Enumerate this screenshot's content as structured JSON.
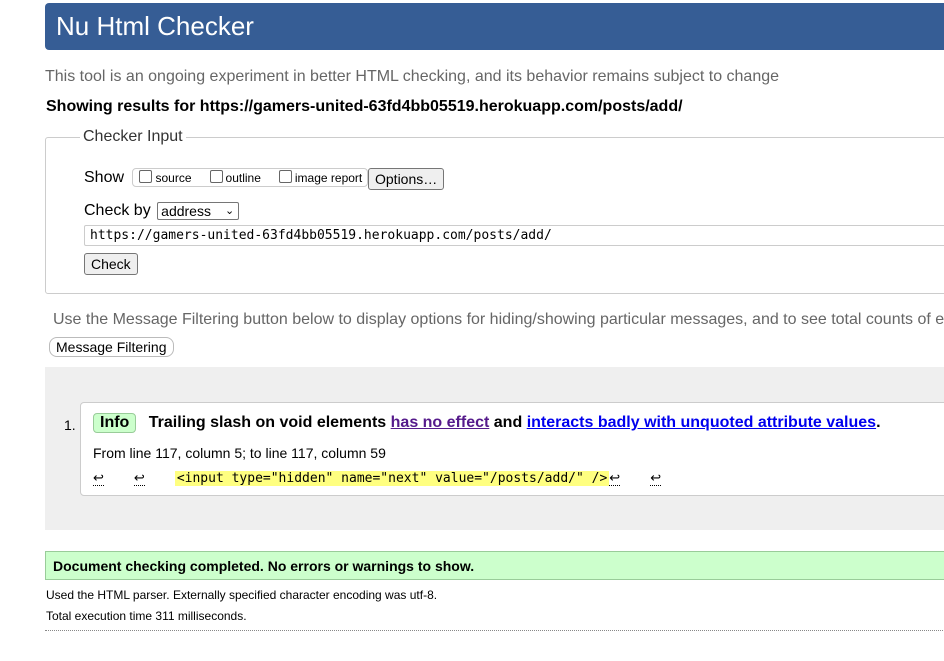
{
  "header": {
    "title": "Nu Html Checker"
  },
  "intro": "This tool is an ongoing experiment in better HTML checking, and its behavior remains subject to change",
  "showing": "Showing results for https://gamers-united-63fd4bb05519.herokuapp.com/posts/add/",
  "checker_input": {
    "legend": "Checker Input",
    "show_label": "Show",
    "options": [
      {
        "label": "source",
        "checked": false
      },
      {
        "label": "outline",
        "checked": false
      },
      {
        "label": "image report",
        "checked": false
      }
    ],
    "options_button": "Options…",
    "check_by_label": "Check by",
    "check_by_value": "address",
    "url_value": "https://gamers-united-63fd4bb05519.herokuapp.com/posts/add/",
    "check_button": "Check"
  },
  "filter_intro": "Use the Message Filtering button below to display options for hiding/showing particular messages, and to see total counts of e",
  "filter_button": "Message Filtering",
  "messages": [
    {
      "number": "1.",
      "type": "Info",
      "title": "Trailing slash on void elements",
      "link1": "has no effect",
      "and_text": "and",
      "link2": "interacts badly with unquoted attribute values",
      "period": ".",
      "location": "From line 117, column 5; to line 117, column 59",
      "extract_code": "<input type=\"hidden\" name=\"next\" value=\"/posts/add/\" />",
      "lf_glyph": "↩"
    }
  ],
  "success": "Document checking completed. No errors or warnings to show.",
  "parser_info": "Used the HTML parser. Externally specified character encoding was utf-8.",
  "exec_time": "Total execution time 311 milliseconds.",
  "colors": {
    "header_bg": "#365d95",
    "info_badge_bg": "#ccffcc",
    "success_bg": "#ccffcc",
    "highlight": "#ffff80",
    "visited_link": "#551a8b",
    "link": "#0000ee"
  }
}
